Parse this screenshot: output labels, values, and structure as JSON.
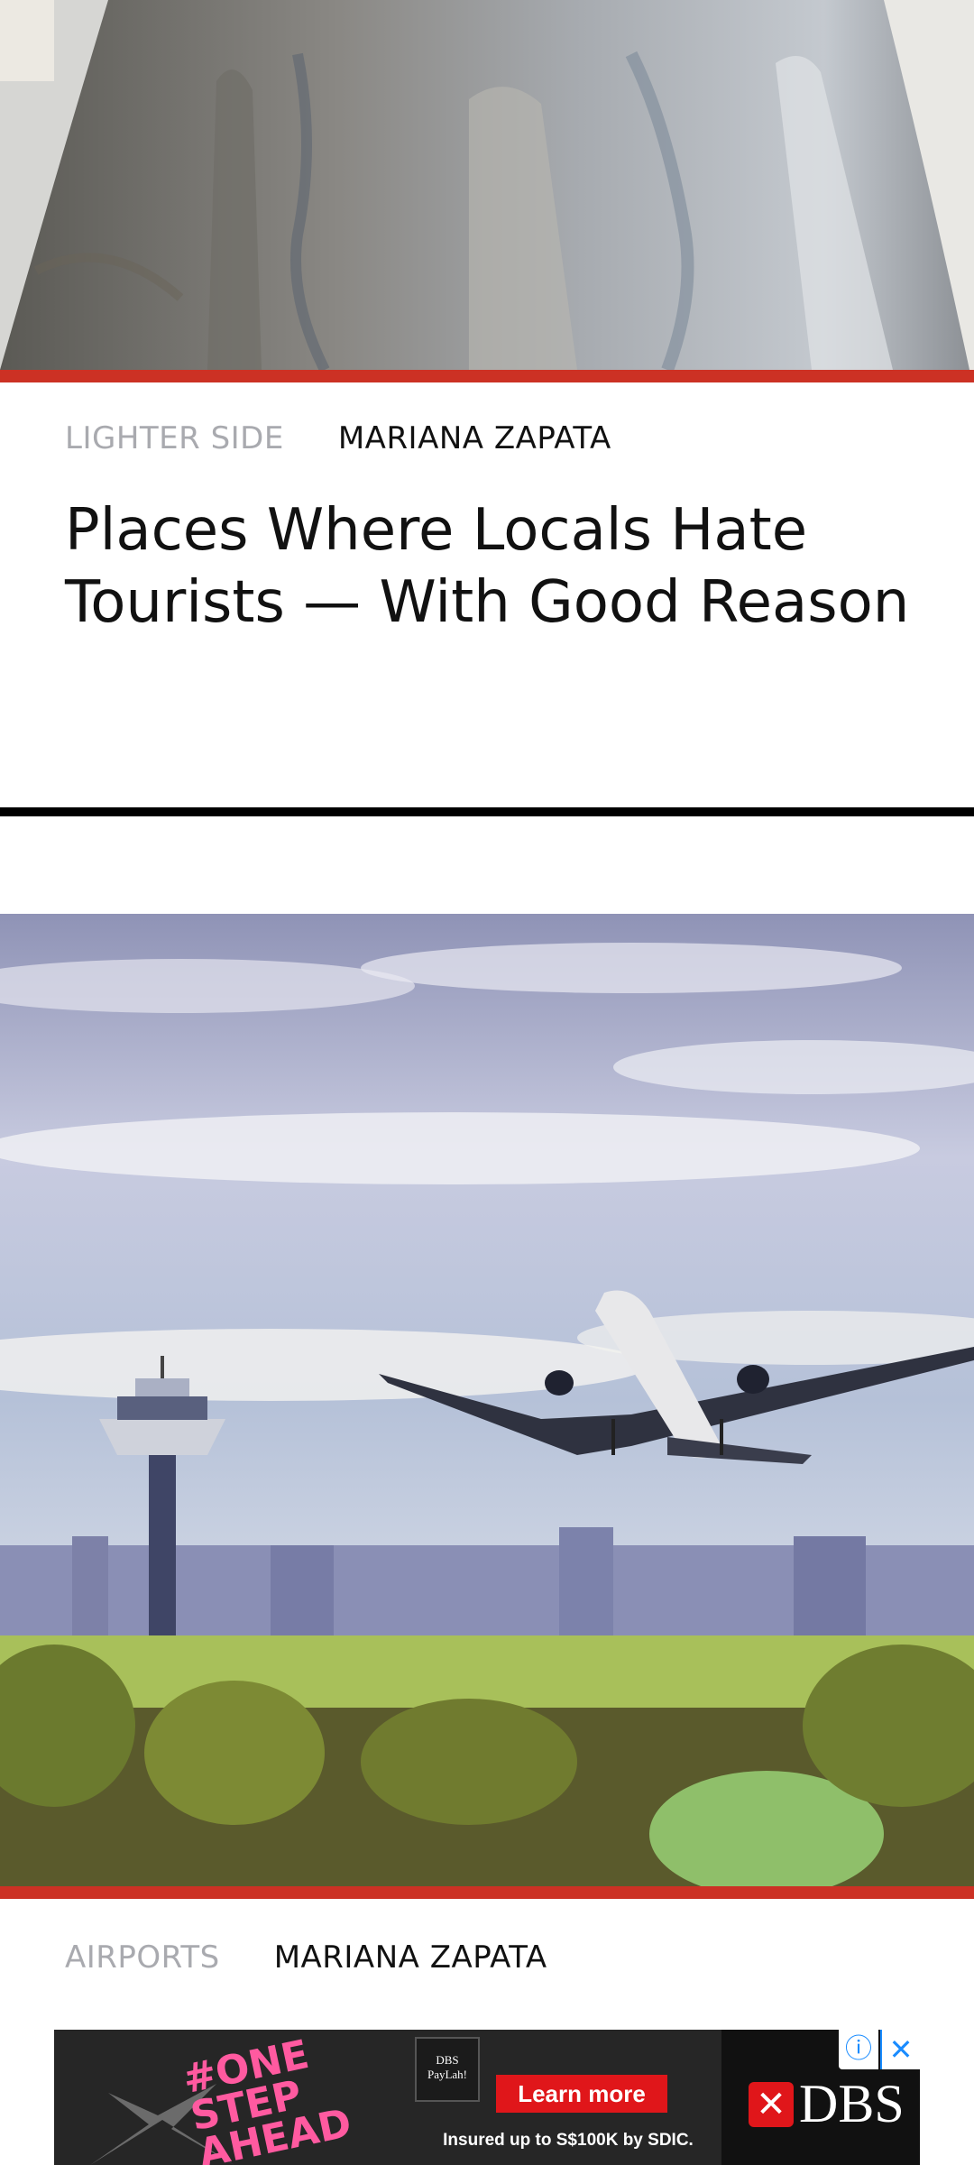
{
  "articles": [
    {
      "category": "LIGHTER SIDE",
      "author": "MARIANA ZAPATA",
      "title": "Places Where Locals Hate Tourists — With Good Reason"
    },
    {
      "category": "AIRPORTS",
      "author": "MARIANA ZAPATA"
    }
  ],
  "ad": {
    "slogan": "#ONE STEP AHEAD",
    "badge_text": "DBS PayLah!",
    "cta_label": "Learn more",
    "disclaimer": "Insured up to S$100K by SDIC.",
    "brand": "DBS",
    "info_symbol": "ⓘ",
    "close_symbol": "✕"
  },
  "colors": {
    "accent_red": "#cc3124",
    "category_gray": "#a9aaaf",
    "text": "#111111"
  }
}
